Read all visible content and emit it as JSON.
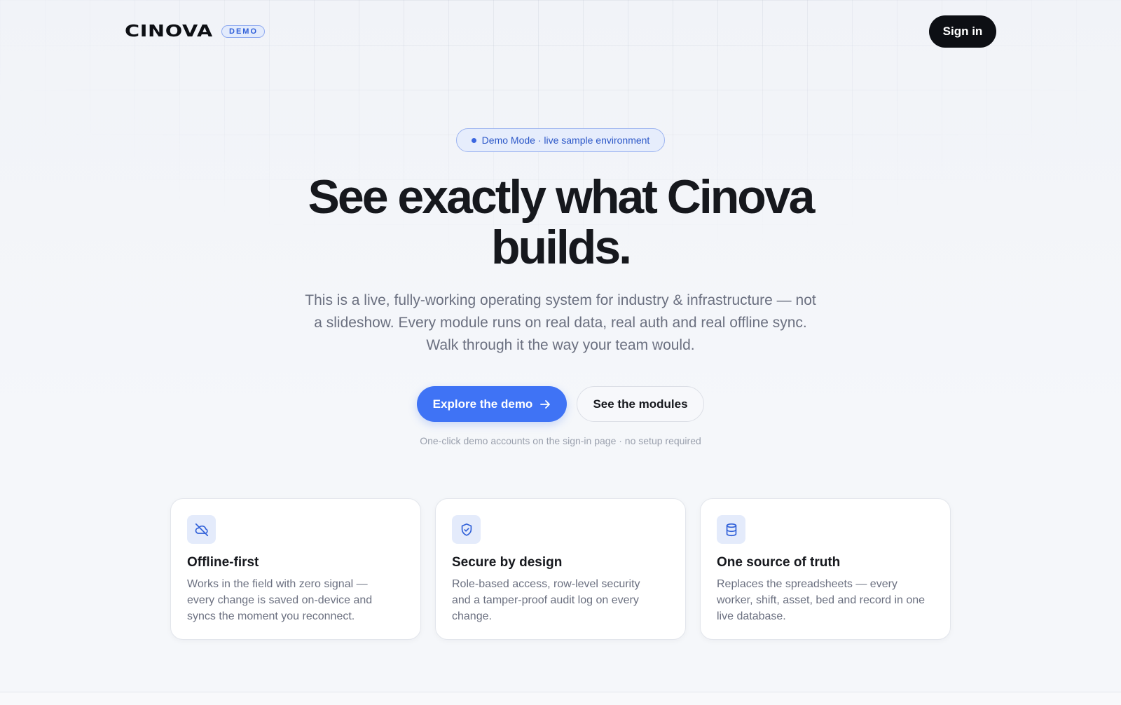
{
  "header": {
    "logo_text": "CINOVA",
    "badge": "DEMO",
    "sign_in": "Sign in"
  },
  "hero": {
    "pill": "Demo Mode · live sample environment",
    "title_line1": "See exactly what Cinova",
    "title_line2": "builds.",
    "subtitle_line1": "This is a live, fully-working operating system for industry & infrastructure — not",
    "subtitle_line2": "a slideshow. Every module runs on real data, real auth and real offline sync.",
    "subtitle_line3": "Walk through it the way your team would.",
    "primary_cta": "Explore the demo",
    "secondary_cta": "See the modules",
    "note": "One-click demo accounts on the sign-in page · no setup required"
  },
  "features": [
    {
      "icon": "cloud-off-icon",
      "title": "Offline-first",
      "desc_line1": "Works in the field with zero signal —",
      "desc_line2": "every change is saved on-device and",
      "desc_line3": "syncs the moment you reconnect."
    },
    {
      "icon": "shield-check-icon",
      "title": "Secure by design",
      "desc_line1": "Role-based access, row-level security",
      "desc_line2": "and a tamper-proof audit log on every",
      "desc_line3": "change."
    },
    {
      "icon": "database-icon",
      "title": "One source of truth",
      "desc_line1": "Replaces the spreadsheets — every",
      "desc_line2": "worker, shift, asset, bed and record in one",
      "desc_line3": "live database."
    }
  ],
  "colors": {
    "accent": "#3f73f5",
    "ink": "#0d0f14",
    "muted": "#6b7080"
  }
}
